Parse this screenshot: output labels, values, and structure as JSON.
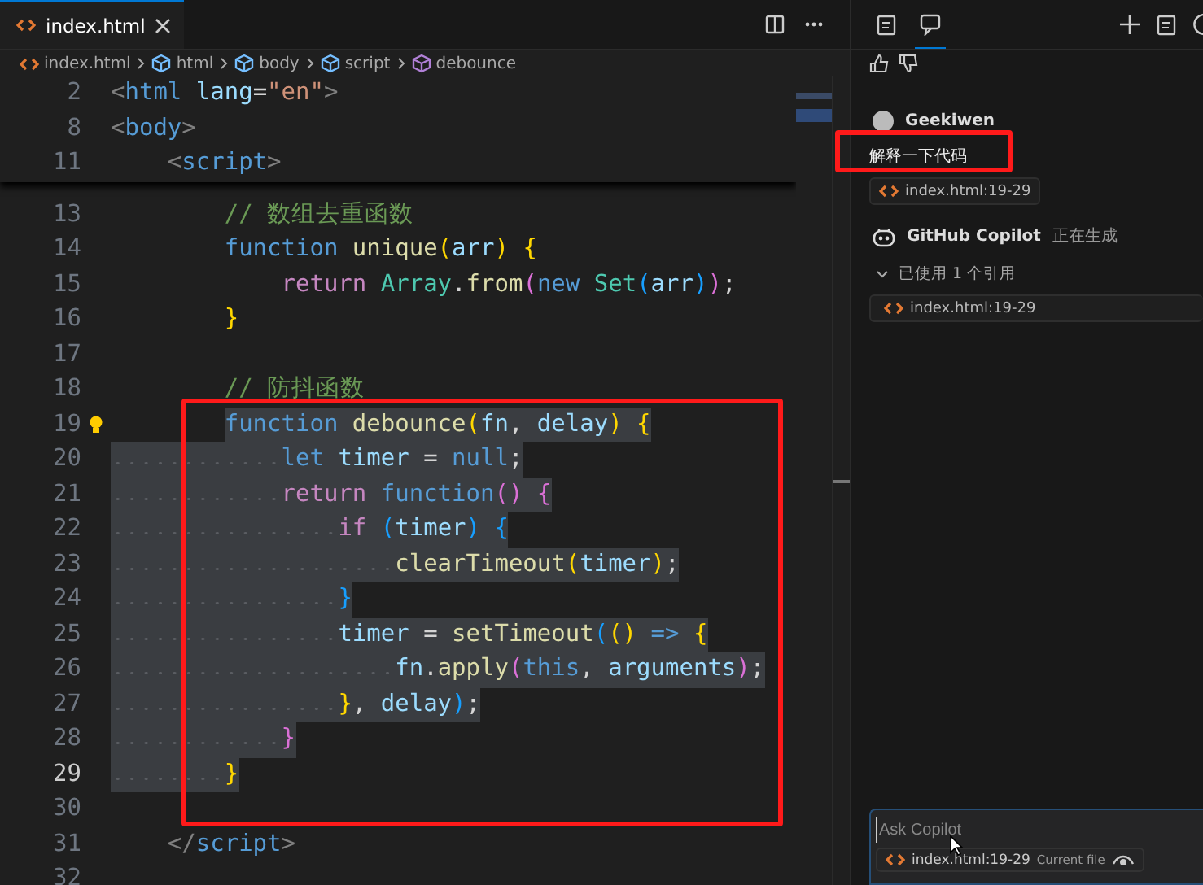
{
  "editor": {
    "tabs": [
      {
        "label": "index.html",
        "selected": true
      }
    ],
    "breadcrumb": [
      {
        "label": "index.html",
        "kind": "file"
      },
      {
        "label": "html",
        "kind": "element"
      },
      {
        "label": "body",
        "kind": "element"
      },
      {
        "label": "script",
        "kind": "element"
      },
      {
        "label": "debounce",
        "kind": "function"
      }
    ],
    "sticky_lines": [
      {
        "number": "2",
        "tokens": [
          {
            "kind": "tagp",
            "text": "<"
          },
          {
            "kind": "tag",
            "text": "html"
          },
          {
            "kind": "attr",
            "text": " lang"
          },
          {
            "kind": "pun",
            "text": "="
          },
          {
            "kind": "str",
            "text": "\"en\""
          },
          {
            "kind": "tagp",
            "text": ">"
          }
        ]
      },
      {
        "number": "8",
        "tokens": [
          {
            "kind": "tagp",
            "text": "<"
          },
          {
            "kind": "tag",
            "text": "body"
          },
          {
            "kind": "tagp",
            "text": ">"
          }
        ]
      },
      {
        "number": "11",
        "tokens": [
          {
            "kind": "tagp",
            "text": "    <"
          },
          {
            "kind": "tag",
            "text": "script"
          },
          {
            "kind": "tagp",
            "text": ">"
          }
        ]
      }
    ],
    "lines": [
      {
        "number": "13",
        "selected": false,
        "current": false,
        "lightbulb": false,
        "tokens": [
          {
            "kind": "cmt",
            "text": "        // 数组去重函数"
          }
        ]
      },
      {
        "number": "14",
        "selected": false,
        "current": false,
        "lightbulb": false,
        "tokens": [
          {
            "kind": "kw",
            "text": "        function"
          },
          {
            "kind": "fn",
            "text": " unique"
          },
          {
            "kind": "b1",
            "text": "("
          },
          {
            "kind": "var",
            "text": "arr"
          },
          {
            "kind": "b1",
            "text": ")"
          },
          {
            "kind": "b1",
            "text": " {"
          }
        ]
      },
      {
        "number": "15",
        "selected": false,
        "current": false,
        "lightbulb": false,
        "tokens": [
          {
            "kind": "ctl",
            "text": "            return"
          },
          {
            "kind": "cls",
            "text": " Array"
          },
          {
            "kind": "pun",
            "text": "."
          },
          {
            "kind": "fn",
            "text": "from"
          },
          {
            "kind": "b2",
            "text": "("
          },
          {
            "kind": "kw",
            "text": "new"
          },
          {
            "kind": "cls",
            "text": " Set"
          },
          {
            "kind": "b3",
            "text": "("
          },
          {
            "kind": "var",
            "text": "arr"
          },
          {
            "kind": "b3",
            "text": ")"
          },
          {
            "kind": "b2",
            "text": ")"
          },
          {
            "kind": "pun",
            "text": ";"
          }
        ]
      },
      {
        "number": "16",
        "selected": false,
        "current": false,
        "lightbulb": false,
        "tokens": [
          {
            "kind": "b1",
            "text": "        }"
          }
        ]
      },
      {
        "number": "17",
        "selected": false,
        "current": false,
        "lightbulb": false
      },
      {
        "number": "18",
        "selected": false,
        "current": false,
        "lightbulb": false,
        "tokens": [
          {
            "kind": "cmt",
            "text": "        // 防抖函数"
          }
        ]
      },
      {
        "number": "19",
        "selected": true,
        "current": false,
        "lightbulb": true,
        "tokens": [
          {
            "kind": "kw",
            "text": "        function"
          },
          {
            "kind": "fn",
            "text": " debounce"
          },
          {
            "kind": "b1",
            "text": "("
          },
          {
            "kind": "var",
            "text": "fn"
          },
          {
            "kind": "pun",
            "text": ","
          },
          {
            "kind": "var",
            "text": " delay"
          },
          {
            "kind": "b1",
            "text": ")"
          },
          {
            "kind": "b1",
            "text": " {"
          }
        ]
      },
      {
        "number": "20",
        "selected": true,
        "current": false,
        "lightbulb": false,
        "tokens": [
          {
            "kind": "kw",
            "text": "            let"
          },
          {
            "kind": "var",
            "text": " timer"
          },
          {
            "kind": "pun",
            "text": " ="
          },
          {
            "kind": "kw",
            "text": " null"
          },
          {
            "kind": "pun",
            "text": ";"
          }
        ]
      },
      {
        "number": "21",
        "selected": true,
        "current": false,
        "lightbulb": false,
        "tokens": [
          {
            "kind": "ctl",
            "text": "            return"
          },
          {
            "kind": "kw",
            "text": " function"
          },
          {
            "kind": "b2",
            "text": "()"
          },
          {
            "kind": "b2",
            "text": " {"
          }
        ]
      },
      {
        "number": "22",
        "selected": true,
        "current": false,
        "lightbulb": false,
        "tokens": [
          {
            "kind": "ctl",
            "text": "                if"
          },
          {
            "kind": "b3",
            "text": " ("
          },
          {
            "kind": "var",
            "text": "timer"
          },
          {
            "kind": "b3",
            "text": ")"
          },
          {
            "kind": "b3",
            "text": " {"
          }
        ]
      },
      {
        "number": "23",
        "selected": true,
        "current": false,
        "lightbulb": false,
        "tokens": [
          {
            "kind": "fn",
            "text": "                    clearTimeout"
          },
          {
            "kind": "b1",
            "text": "("
          },
          {
            "kind": "var",
            "text": "timer"
          },
          {
            "kind": "b1",
            "text": ")"
          },
          {
            "kind": "pun",
            "text": ";"
          }
        ]
      },
      {
        "number": "24",
        "selected": true,
        "current": false,
        "lightbulb": false,
        "tokens": [
          {
            "kind": "b3",
            "text": "                }"
          }
        ]
      },
      {
        "number": "25",
        "selected": true,
        "current": false,
        "lightbulb": false,
        "tokens": [
          {
            "kind": "var",
            "text": "                timer"
          },
          {
            "kind": "pun",
            "text": " ="
          },
          {
            "kind": "fn",
            "text": " setTimeout"
          },
          {
            "kind": "b3",
            "text": "("
          },
          {
            "kind": "b1",
            "text": "()"
          },
          {
            "kind": "kw",
            "text": " =>"
          },
          {
            "kind": "b1",
            "text": " {"
          }
        ]
      },
      {
        "number": "26",
        "selected": true,
        "current": false,
        "lightbulb": false,
        "tokens": [
          {
            "kind": "var",
            "text": "                    fn"
          },
          {
            "kind": "pun",
            "text": "."
          },
          {
            "kind": "fn",
            "text": "apply"
          },
          {
            "kind": "b2",
            "text": "("
          },
          {
            "kind": "kw",
            "text": "this"
          },
          {
            "kind": "pun",
            "text": ","
          },
          {
            "kind": "var",
            "text": " arguments"
          },
          {
            "kind": "b2",
            "text": ")"
          },
          {
            "kind": "pun",
            "text": ";"
          }
        ]
      },
      {
        "number": "27",
        "selected": true,
        "current": false,
        "lightbulb": false,
        "tokens": [
          {
            "kind": "b1",
            "text": "                }"
          },
          {
            "kind": "pun",
            "text": ","
          },
          {
            "kind": "var",
            "text": " delay"
          },
          {
            "kind": "b3",
            "text": ")"
          },
          {
            "kind": "pun",
            "text": ";"
          }
        ]
      },
      {
        "number": "28",
        "selected": true,
        "current": false,
        "lightbulb": false,
        "tokens": [
          {
            "kind": "b2",
            "text": "            }"
          }
        ]
      },
      {
        "number": "29",
        "selected": true,
        "current": true,
        "lightbulb": false,
        "tokens": [
          {
            "kind": "b1",
            "text": "        }"
          }
        ]
      },
      {
        "number": "30",
        "selected": false,
        "current": false,
        "lightbulb": false
      },
      {
        "number": "31",
        "selected": false,
        "current": false,
        "lightbulb": false,
        "tokens": [
          {
            "kind": "tagp",
            "text": "    </"
          },
          {
            "kind": "tag",
            "text": "script"
          },
          {
            "kind": "tagp",
            "text": ">"
          }
        ]
      },
      {
        "number": "32",
        "selected": false,
        "current": false,
        "lightbulb": false
      }
    ],
    "selection_frame": true
  },
  "chat": {
    "view_tabs": [
      {
        "selected": false
      },
      {
        "selected": true
      }
    ],
    "messages": [
      {
        "kind": "user",
        "author": "Geekiwen",
        "text": "解释一下代码",
        "highlighted": true,
        "references": [
          {
            "label": "index.html:19-29"
          }
        ]
      },
      {
        "kind": "assistant",
        "author": "GitHub Copilot",
        "highlighted": false,
        "status": "正在生成",
        "used_references": {
          "label": "已使用 1 个引用",
          "expanded": true,
          "items": [
            {
              "label": "index.html:19-29"
            }
          ]
        }
      }
    ],
    "input": {
      "placeholder": "Ask Copilot",
      "context": {
        "label": "index.html:19-29",
        "note": "Current file"
      }
    }
  }
}
